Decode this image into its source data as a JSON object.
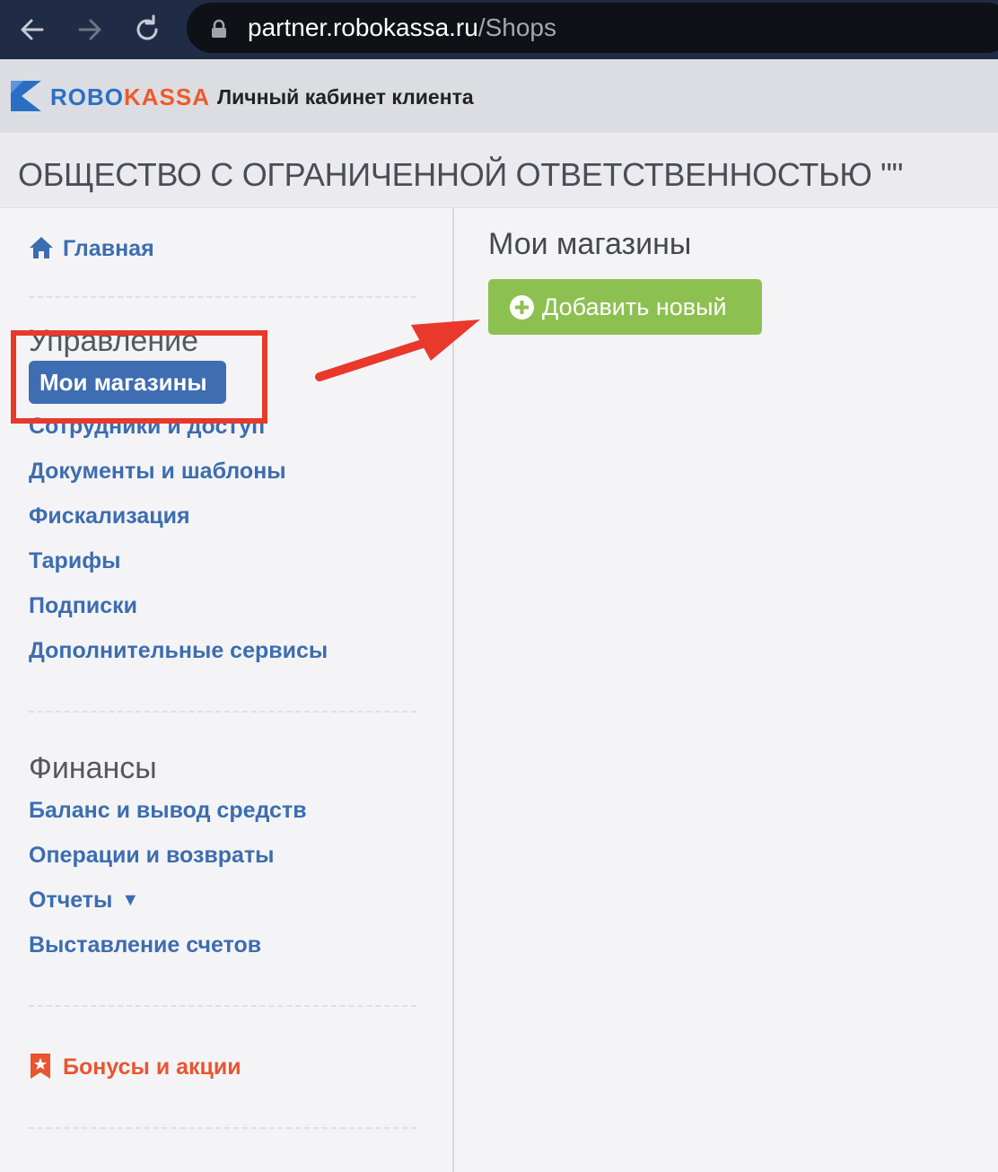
{
  "browser": {
    "url_host": "partner.robokassa.ru",
    "url_path": "/Shops"
  },
  "header": {
    "logo_robo": "ROBO",
    "logo_kassa": "KASSA",
    "title": "Личный кабинет клиента"
  },
  "company": {
    "name": "ОБЩЕСТВО С ОГРАНИЧЕННОЙ ОТВЕТСТВЕННОСТЬЮ \"\""
  },
  "sidebar": {
    "home": "Главная",
    "management_title": "Управление",
    "management_items": [
      "Мои магазины",
      "Сотрудники и доступ",
      "Документы и шаблоны",
      "Фискализация",
      "Тарифы",
      "Подписки",
      "Дополнительные сервисы"
    ],
    "finance_title": "Финансы",
    "finance_items": [
      "Баланс и вывод средств",
      "Операции и возвраты",
      "Отчеты",
      "Выставление счетов"
    ],
    "bonus": "Бонусы и акции",
    "reports_caret": "▼"
  },
  "main": {
    "title": "Мои магазины",
    "add_button": "Добавить новый"
  },
  "colors": {
    "link": "#3c6db0",
    "active_bg": "#3f6db2",
    "add_button": "#8cc152",
    "highlight": "#e8392b",
    "bonus": "#e9552f"
  },
  "icons": {
    "back": "arrow-left-icon",
    "forward": "arrow-right-icon",
    "reload": "reload-icon",
    "lock": "lock-icon",
    "home": "home-icon",
    "bonus": "bookmark-star-icon",
    "add": "plus-circle-icon"
  }
}
